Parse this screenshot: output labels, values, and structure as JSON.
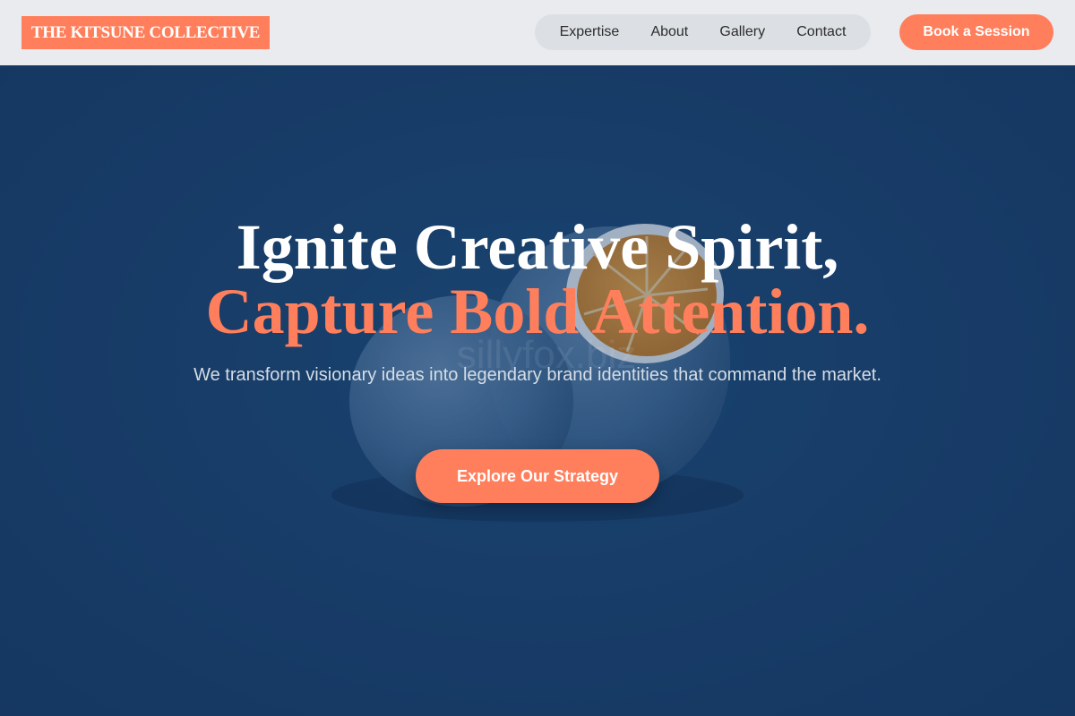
{
  "header": {
    "logo": "THE KITSUNE COLLECTIVE",
    "nav": [
      {
        "label": "Expertise"
      },
      {
        "label": "About"
      },
      {
        "label": "Gallery"
      },
      {
        "label": "Contact"
      }
    ],
    "cta_label": "Book a Session"
  },
  "hero": {
    "headline_line1": "Ignite Creative Spirit,",
    "headline_line2": "Capture Bold Attention.",
    "subtitle": "We transform visionary ideas into legendary brand identities that command the market.",
    "cta_label": "Explore Our Strategy",
    "background_image": "blue-painted-orange-icon",
    "watermark": "sillyfox.biz"
  },
  "colors": {
    "accent": "#ff7f5c",
    "hero_bg": "#173a63",
    "header_bg": "#e9ebee"
  }
}
